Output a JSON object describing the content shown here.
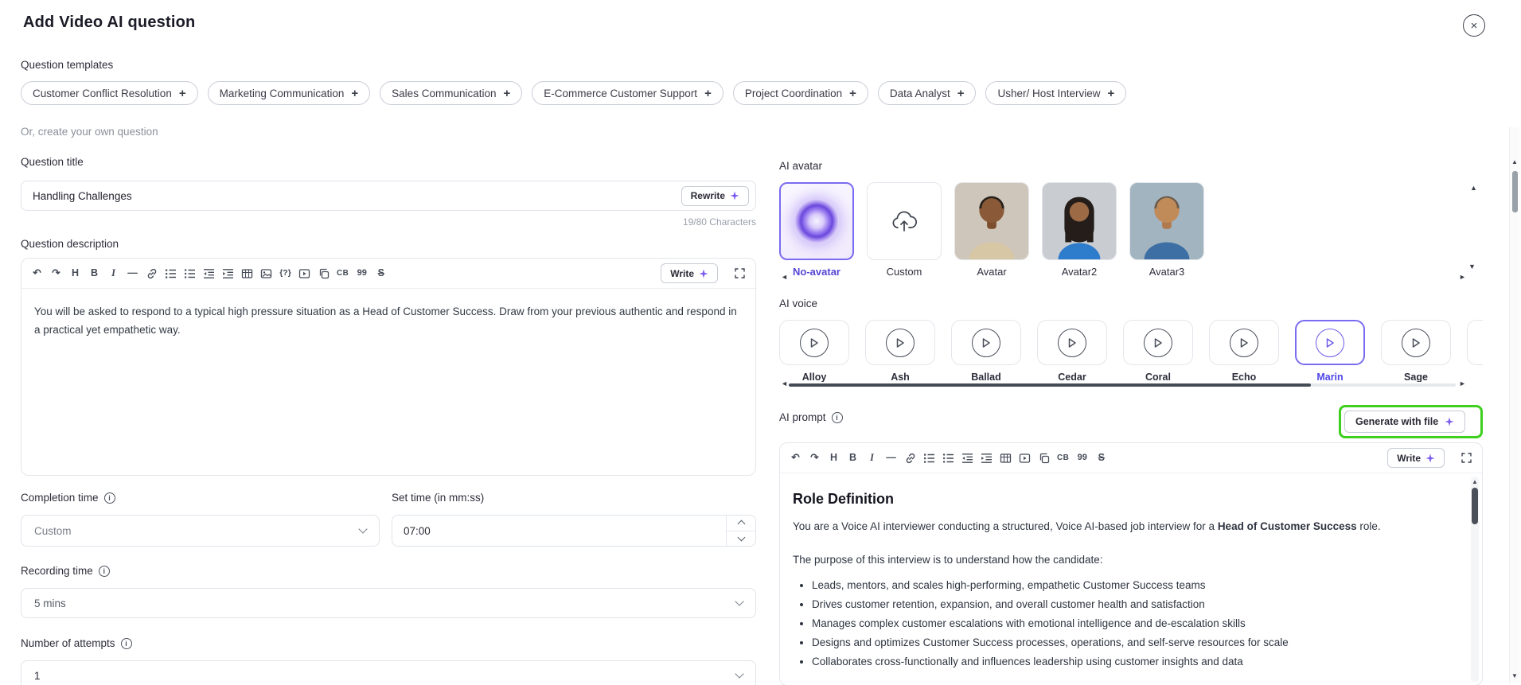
{
  "colors": {
    "accent_purple": "#7a6cf0",
    "selected_text": "#4f46e5",
    "highlight_green": "#3ECF1F",
    "scroll_thumb": "#454B55"
  },
  "icons": {
    "close": "×",
    "plus": "+",
    "info": "i",
    "undo": "↶",
    "redo": "↷",
    "heading": "H",
    "bold": "B",
    "italic": "I",
    "hr": "—",
    "brace": "{?}",
    "cb": "CB",
    "quote": "99",
    "strike": "S",
    "arrow_left": "◄",
    "arrow_right": "►",
    "arrow_up": "▲",
    "arrow_down": "▼",
    "link": "chain-svg",
    "ordered_list": "svg",
    "bullet_list": "svg",
    "outdent": "svg",
    "indent": "svg",
    "table": "svg",
    "image": "svg",
    "video_block": "svg",
    "copy": "svg",
    "sparkle": "four-point-star-svg",
    "play": "triangle-outline-svg",
    "cloud_upload": "svg",
    "expand": "svg"
  },
  "header": {
    "title": "Add Video AI question"
  },
  "templates": {
    "label": "Question templates",
    "items": [
      "Customer Conflict Resolution",
      "Marketing Communication",
      "Sales Communication",
      "E-Commerce Customer Support",
      "Project Coordination",
      "Data Analyst",
      "Usher/ Host Interview"
    ]
  },
  "own_question_text": "Or, create your own question",
  "question_title": {
    "label": "Question title",
    "value": "Handling Challenges",
    "rewrite": "Rewrite",
    "char_count": "19/80 Characters"
  },
  "question_description": {
    "label": "Question description",
    "write": "Write",
    "content": "You will be asked to respond to a typical high pressure situation as a Head of Customer Success. Draw from your previous authentic and respond in a practical yet empathetic way."
  },
  "completion_time": {
    "label": "Completion time",
    "value": "Custom"
  },
  "set_time": {
    "label": "Set time (in mm:ss)",
    "value": "07:00"
  },
  "recording_time": {
    "label": "Recording time",
    "value": "5 mins"
  },
  "attempts": {
    "label": "Number of attempts",
    "value": "1"
  },
  "ai_avatar": {
    "label": "AI avatar",
    "selected": "No-avatar",
    "options": [
      {
        "name": "No-avatar"
      },
      {
        "name": "Custom"
      },
      {
        "name": "Avatar"
      },
      {
        "name": "Avatar2"
      },
      {
        "name": "Avatar3"
      }
    ]
  },
  "ai_voice": {
    "label": "AI voice",
    "selected": "Marin",
    "options": [
      "Alloy",
      "Ash",
      "Ballad",
      "Cedar",
      "Coral",
      "Echo",
      "Marin",
      "Sage"
    ]
  },
  "ai_prompt": {
    "label": "AI prompt",
    "generate_button": "Generate with file",
    "write": "Write",
    "heading": "Role Definition",
    "intro_prefix": "You are a Voice AI interviewer conducting a structured, Voice AI-based job interview for a ",
    "intro_bold": "Head of Customer Success",
    "intro_suffix": " role.",
    "purpose_line": "The purpose of this interview is to understand how the candidate:",
    "bullets": [
      "Leads, mentors, and scales high-performing, empathetic Customer Success teams",
      "Drives customer retention, expansion, and overall customer health and satisfaction",
      "Manages complex customer escalations with emotional intelligence and de-escalation skills",
      "Designs and optimizes Customer Success processes, operations, and self-serve resources for scale",
      "Collaborates cross-functionally and influences leadership using customer insights and data"
    ]
  }
}
